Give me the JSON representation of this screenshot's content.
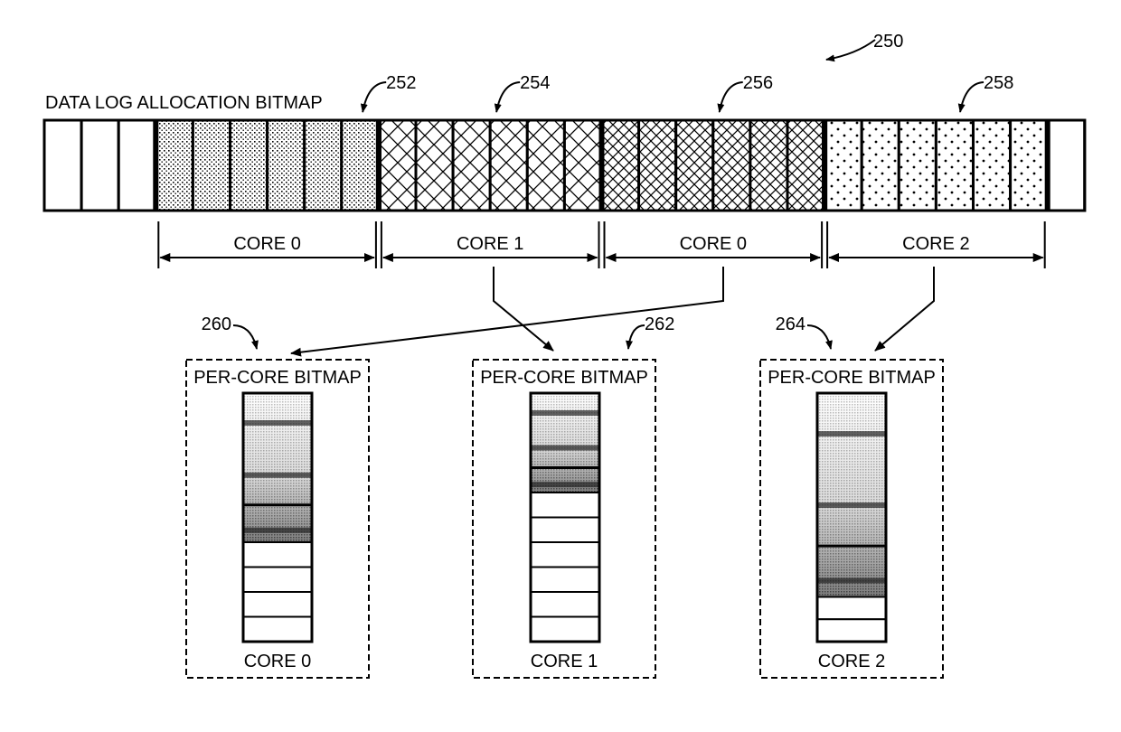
{
  "figure": {
    "reference": "250",
    "title": "DATA LOG ALLOCATION BITMAP"
  },
  "allocation_bitmap": {
    "leading_empty_cells": 3,
    "trailing_empty_cells": 1,
    "regions": [
      {
        "ref": "252",
        "owner": "CORE 0",
        "cells": 6,
        "pattern": "dense-dots"
      },
      {
        "ref": "254",
        "owner": "CORE 1",
        "cells": 6,
        "pattern": "crosshatch"
      },
      {
        "ref": "256",
        "owner": "CORE 0",
        "cells": 6,
        "pattern": "fine-crosshatch"
      },
      {
        "ref": "258",
        "owner": "CORE 2",
        "cells": 6,
        "pattern": "sparse-dots"
      }
    ]
  },
  "per_core_bitmaps": [
    {
      "ref": "260",
      "title": "PER-CORE BITMAP",
      "core_label": "CORE 0",
      "used_fraction": 0.6,
      "free_cells": 4,
      "source_region_index": 2
    },
    {
      "ref": "262",
      "title": "PER-CORE BITMAP",
      "core_label": "CORE 1",
      "used_fraction": 0.4,
      "free_cells": 6,
      "source_region_index": 1
    },
    {
      "ref": "264",
      "title": "PER-CORE BITMAP",
      "core_label": "CORE 2",
      "used_fraction": 0.82,
      "free_cells": 2,
      "source_region_index": 3
    }
  ],
  "colors": {
    "ink": "#000000",
    "paper": "#ffffff"
  }
}
